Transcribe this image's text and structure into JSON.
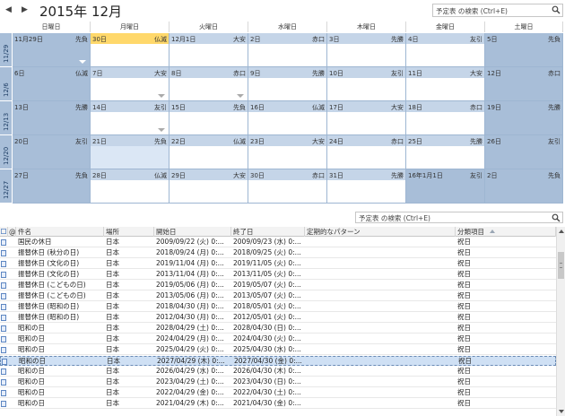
{
  "header": {
    "prev_icon": "left-triangle-icon",
    "next_icon": "right-triangle-icon",
    "prev_glyph": "◀",
    "next_glyph": "▶",
    "title": "2015年 12月",
    "search_placeholder": "予定表 の検索 (Ctrl+E)"
  },
  "calendar": {
    "weekdays": [
      "日曜日",
      "月曜日",
      "火曜日",
      "水曜日",
      "木曜日",
      "金曜日",
      "土曜日"
    ],
    "weeks": [
      {
        "label": "11/29",
        "days": [
          {
            "date": "11月29日",
            "rokuyo": "先負",
            "type": "weekend",
            "more": "white"
          },
          {
            "date": "30日",
            "rokuyo": "仏滅",
            "type": "today"
          },
          {
            "date": "12月1日",
            "rokuyo": "大安",
            "type": "normal"
          },
          {
            "date": "2日",
            "rokuyo": "赤口",
            "type": "normal"
          },
          {
            "date": "3日",
            "rokuyo": "先勝",
            "type": "normal"
          },
          {
            "date": "4日",
            "rokuyo": "友引",
            "type": "normal"
          },
          {
            "date": "5日",
            "rokuyo": "先負",
            "type": "weekend"
          }
        ]
      },
      {
        "label": "12/6",
        "days": [
          {
            "date": "6日",
            "rokuyo": "仏滅",
            "type": "weekend"
          },
          {
            "date": "7日",
            "rokuyo": "大安",
            "type": "normal",
            "more": "gray"
          },
          {
            "date": "8日",
            "rokuyo": "赤口",
            "type": "normal",
            "more": "gray"
          },
          {
            "date": "9日",
            "rokuyo": "先勝",
            "type": "normal"
          },
          {
            "date": "10日",
            "rokuyo": "友引",
            "type": "normal"
          },
          {
            "date": "11日",
            "rokuyo": "大安",
            "type": "normal"
          },
          {
            "date": "12日",
            "rokuyo": "赤口",
            "type": "weekend"
          }
        ]
      },
      {
        "label": "12/13",
        "days": [
          {
            "date": "13日",
            "rokuyo": "先勝",
            "type": "weekend"
          },
          {
            "date": "14日",
            "rokuyo": "友引",
            "type": "normal",
            "more": "gray"
          },
          {
            "date": "15日",
            "rokuyo": "先負",
            "type": "normal"
          },
          {
            "date": "16日",
            "rokuyo": "仏滅",
            "type": "normal"
          },
          {
            "date": "17日",
            "rokuyo": "大安",
            "type": "normal"
          },
          {
            "date": "18日",
            "rokuyo": "赤口",
            "type": "normal"
          },
          {
            "date": "19日",
            "rokuyo": "先勝",
            "type": "weekend"
          }
        ]
      },
      {
        "label": "12/20",
        "days": [
          {
            "date": "20日",
            "rokuyo": "友引",
            "type": "weekend"
          },
          {
            "date": "21日",
            "rokuyo": "先負",
            "type": "selected"
          },
          {
            "date": "22日",
            "rokuyo": "仏滅",
            "type": "normal"
          },
          {
            "date": "23日",
            "rokuyo": "大安",
            "type": "normal"
          },
          {
            "date": "24日",
            "rokuyo": "赤口",
            "type": "normal"
          },
          {
            "date": "25日",
            "rokuyo": "先勝",
            "type": "normal"
          },
          {
            "date": "26日",
            "rokuyo": "友引",
            "type": "weekend"
          }
        ]
      },
      {
        "label": "12/27",
        "days": [
          {
            "date": "27日",
            "rokuyo": "先負",
            "type": "weekend"
          },
          {
            "date": "28日",
            "rokuyo": "仏滅",
            "type": "normal"
          },
          {
            "date": "29日",
            "rokuyo": "大安",
            "type": "normal"
          },
          {
            "date": "30日",
            "rokuyo": "赤口",
            "type": "normal"
          },
          {
            "date": "31日",
            "rokuyo": "先勝",
            "type": "normal"
          },
          {
            "date": "16年1月1日",
            "rokuyo": "友引",
            "type": "weekend"
          },
          {
            "date": "2日",
            "rokuyo": "先負",
            "type": "weekend"
          }
        ]
      }
    ]
  },
  "list": {
    "search_placeholder": "予定表 の検索 (Ctrl+E)",
    "columns": [
      "件名",
      "場所",
      "開始日",
      "終了日",
      "定期的なパターン",
      "分類項目"
    ],
    "rows": [
      {
        "subject": "国民の休日",
        "location": "日本",
        "start": "2009/09/22 (火) 0:...",
        "end": "2009/09/23 (水) 0:...",
        "pattern": "",
        "category": "祝日"
      },
      {
        "subject": "振替休日 (秋分の日)",
        "location": "日本",
        "start": "2018/09/24 (月) 0:...",
        "end": "2018/09/25 (火) 0:...",
        "pattern": "",
        "category": "祝日"
      },
      {
        "subject": "振替休日 (文化の日)",
        "location": "日本",
        "start": "2019/11/04 (月) 0:...",
        "end": "2019/11/05 (火) 0:...",
        "pattern": "",
        "category": "祝日"
      },
      {
        "subject": "振替休日 (文化の日)",
        "location": "日本",
        "start": "2013/11/04 (月) 0:...",
        "end": "2013/11/05 (火) 0:...",
        "pattern": "",
        "category": "祝日"
      },
      {
        "subject": "振替休日 (こどもの日)",
        "location": "日本",
        "start": "2019/05/06 (月) 0:...",
        "end": "2019/05/07 (火) 0:...",
        "pattern": "",
        "category": "祝日"
      },
      {
        "subject": "振替休日 (こどもの日)",
        "location": "日本",
        "start": "2013/05/06 (月) 0:...",
        "end": "2013/05/07 (火) 0:...",
        "pattern": "",
        "category": "祝日"
      },
      {
        "subject": "振替休日 (昭和の日)",
        "location": "日本",
        "start": "2018/04/30 (月) 0:...",
        "end": "2018/05/01 (火) 0:...",
        "pattern": "",
        "category": "祝日"
      },
      {
        "subject": "振替休日 (昭和の日)",
        "location": "日本",
        "start": "2012/04/30 (月) 0:...",
        "end": "2012/05/01 (火) 0:...",
        "pattern": "",
        "category": "祝日"
      },
      {
        "subject": "昭和の日",
        "location": "日本",
        "start": "2028/04/29 (土) 0:...",
        "end": "2028/04/30 (日) 0:...",
        "pattern": "",
        "category": "祝日"
      },
      {
        "subject": "昭和の日",
        "location": "日本",
        "start": "2024/04/29 (月) 0:...",
        "end": "2024/04/30 (火) 0:...",
        "pattern": "",
        "category": "祝日"
      },
      {
        "subject": "昭和の日",
        "location": "日本",
        "start": "2025/04/29 (火) 0:...",
        "end": "2025/04/30 (水) 0:...",
        "pattern": "",
        "category": "祝日"
      },
      {
        "subject": "昭和の日",
        "location": "日本",
        "start": "2027/04/29 (木) 0:...",
        "end": "2027/04/30 (金) 0:...",
        "pattern": "",
        "category": "祝日",
        "selected": true
      },
      {
        "subject": "昭和の日",
        "location": "日本",
        "start": "2026/04/29 (水) 0:...",
        "end": "2026/04/30 (木) 0:...",
        "pattern": "",
        "category": "祝日"
      },
      {
        "subject": "昭和の日",
        "location": "日本",
        "start": "2023/04/29 (土) 0:...",
        "end": "2023/04/30 (日) 0:...",
        "pattern": "",
        "category": "祝日"
      },
      {
        "subject": "昭和の日",
        "location": "日本",
        "start": "2022/04/29 (金) 0:...",
        "end": "2022/04/30 (土) 0:...",
        "pattern": "",
        "category": "祝日"
      },
      {
        "subject": "昭和の日",
        "location": "日本",
        "start": "2021/04/29 (木) 0:...",
        "end": "2021/04/30 (金) 0:...",
        "pattern": "",
        "category": "祝日"
      }
    ]
  },
  "colors": {
    "weekend": "#a8bed8",
    "today": "#ffd86b",
    "day_header": "#c5d5e8",
    "selected_row": "#cfe0f4"
  }
}
